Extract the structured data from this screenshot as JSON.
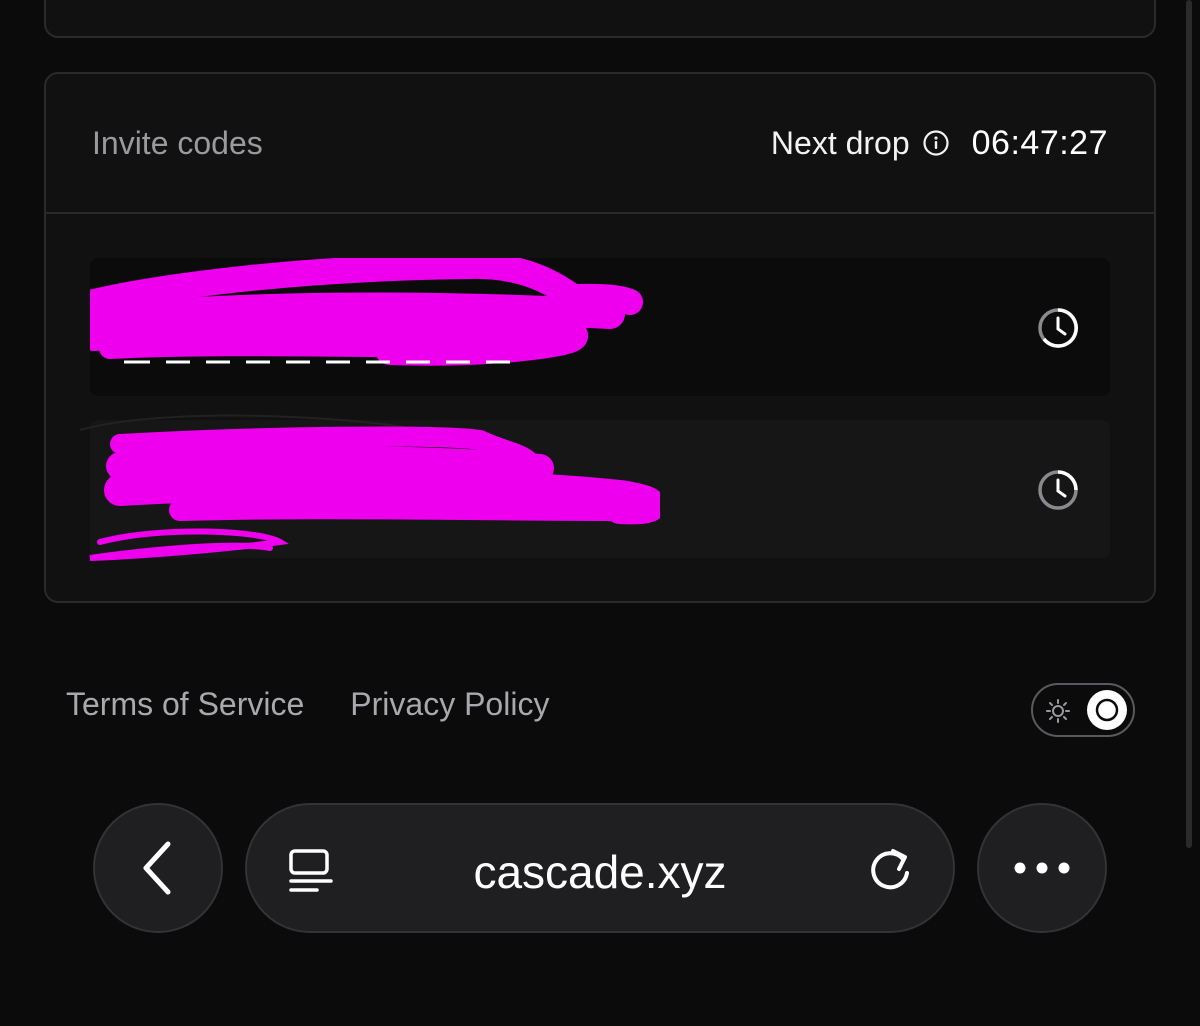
{
  "invite": {
    "title": "Invite codes",
    "next_drop_label": "Next drop",
    "countdown": "06:47:27",
    "codes": [
      {
        "code": "",
        "status_icon": "clock-icon"
      },
      {
        "code": "",
        "status_icon": "clock-icon"
      }
    ]
  },
  "footer": {
    "terms": "Terms of Service",
    "privacy": "Privacy Policy",
    "theme": "dark"
  },
  "browser": {
    "url": "cascade.xyz",
    "back_icon": "chevron-left-icon",
    "reader_icon": "reader-icon",
    "reload_icon": "reload-icon",
    "more_icon": "more-icon"
  },
  "colors": {
    "background": "#0b0b0c",
    "card": "#111112",
    "border": "#2a2a2c",
    "redaction": "#ee00ee"
  }
}
